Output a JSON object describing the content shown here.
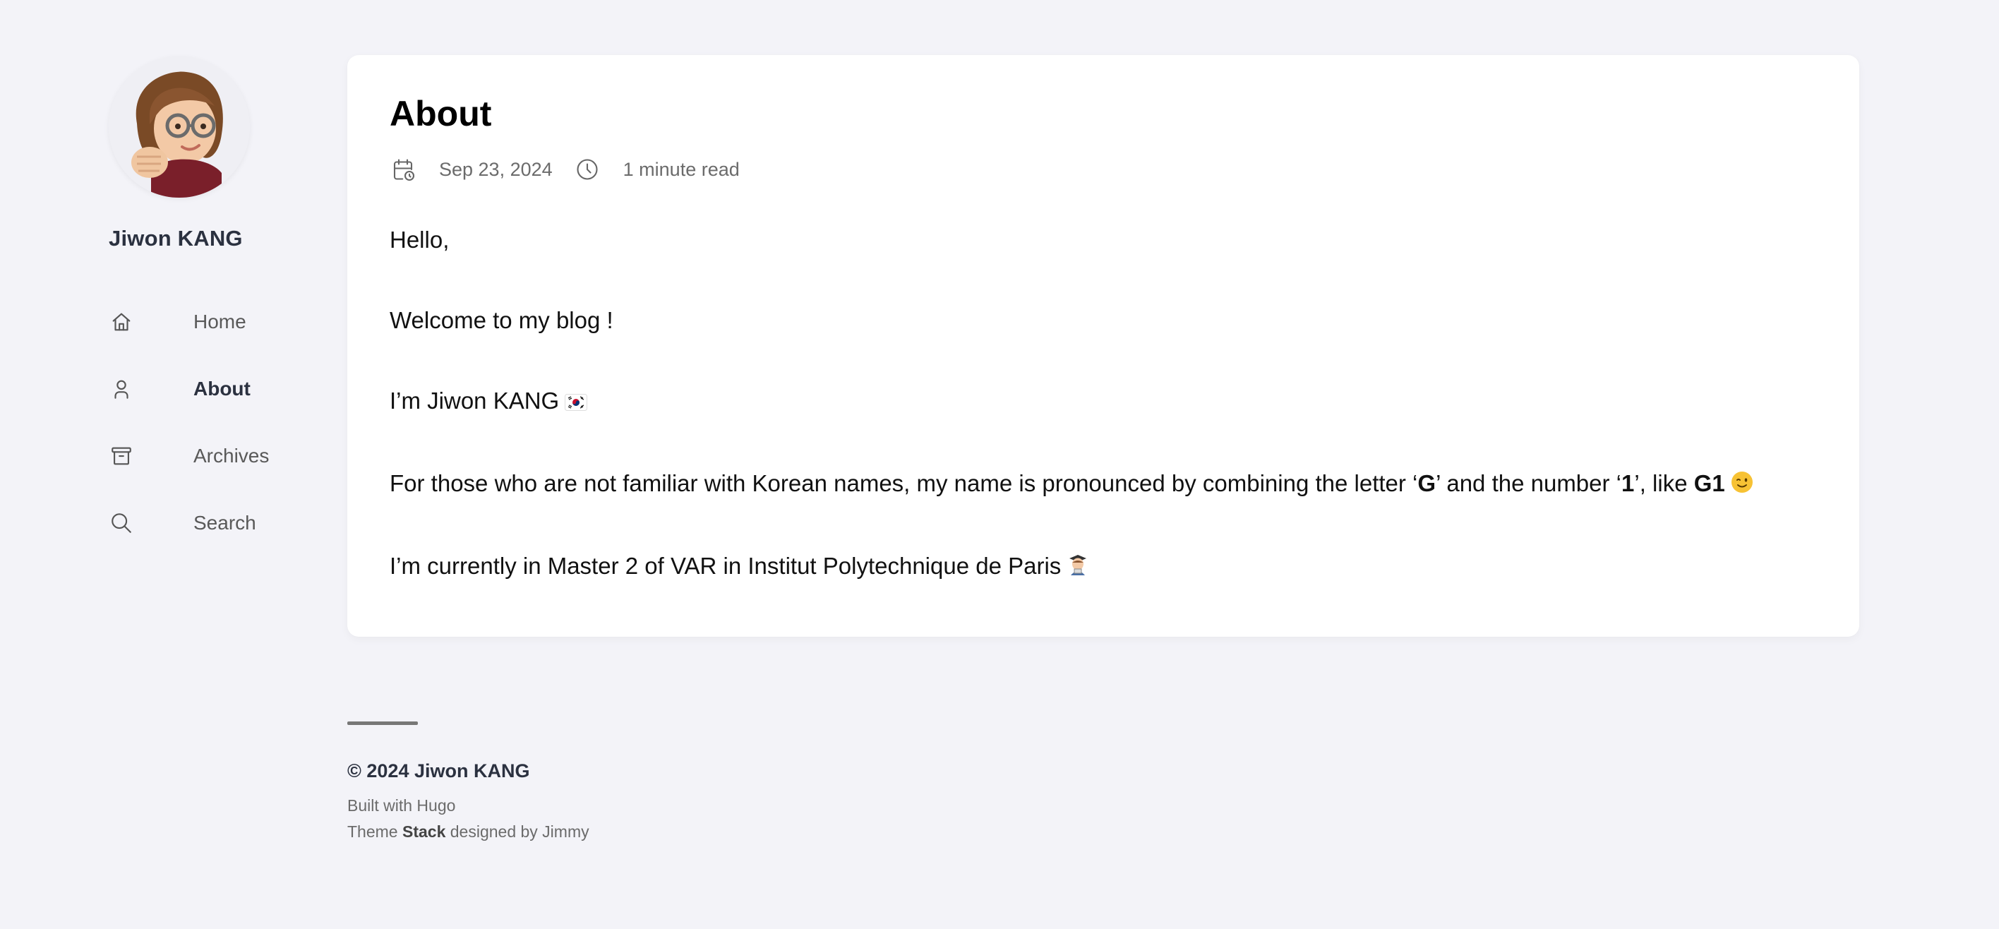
{
  "profile": {
    "name": "Jiwon KANG",
    "avatar_icon": "memoji-avatar"
  },
  "menu": {
    "items": [
      {
        "label": "Home",
        "icon": "home-icon",
        "active": false
      },
      {
        "label": "About",
        "icon": "user-icon",
        "active": true
      },
      {
        "label": "Archives",
        "icon": "archive-icon",
        "active": false
      },
      {
        "label": "Search",
        "icon": "search-icon",
        "active": false
      }
    ]
  },
  "article": {
    "title": "About",
    "date": "Sep 23, 2024",
    "reading_time": "1 minute read",
    "paragraphs": {
      "p1": "Hello,",
      "p2": "Welcome to my blog !",
      "p3": "I’m Jiwon KANG",
      "p4_a": "For those who are not familiar with Korean names, my name is pronounced by combining the letter ‘",
      "p4_b": "G",
      "p4_c": "’ and the number ‘",
      "p4_d": "1",
      "p4_e": "’, like ",
      "p4_f": "G1",
      "p5": "I’m currently in Master 2 of VAR in Institut Polytechnique de Paris"
    }
  },
  "footer": {
    "copyright": "© 2024 Jiwon KANG",
    "built_with": "Built with Hugo",
    "theme_prefix": "Theme",
    "theme_name": "Stack",
    "theme_suffix": "designed by Jimmy"
  },
  "colors": {
    "background": "#f3f3f8",
    "card": "#ffffff",
    "accent_text": "#2b3140",
    "muted_text": "#6b6b6b"
  }
}
